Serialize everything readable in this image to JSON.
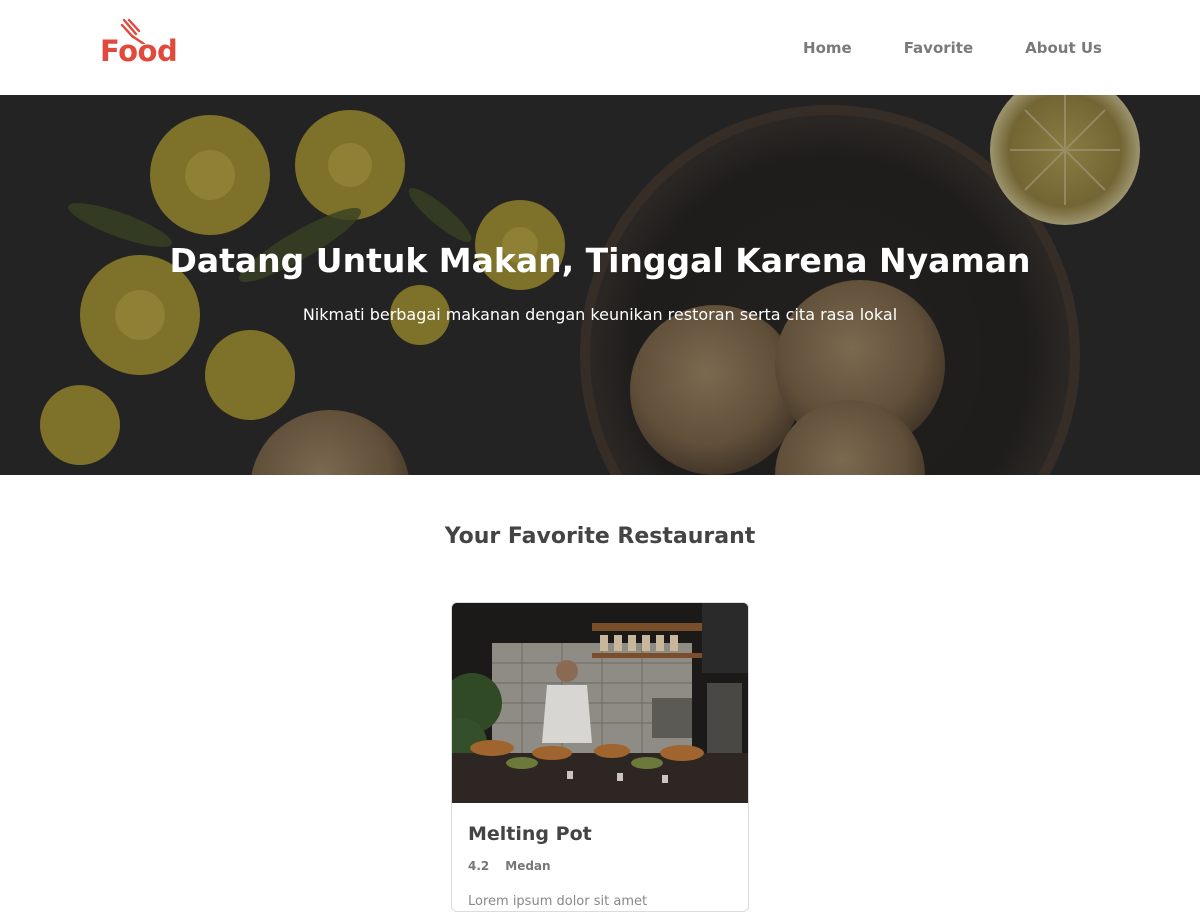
{
  "brand": {
    "logo_text": "Food",
    "accent_color": "#e0493b",
    "icon": "fork-icon"
  },
  "nav": {
    "items": [
      {
        "label": "Home"
      },
      {
        "label": "Favorite"
      },
      {
        "label": "About Us"
      }
    ]
  },
  "hero": {
    "title": "Datang Untuk Makan, Tinggal Karena Nyaman",
    "subtitle": "Nikmati berbagai makanan dengan keunikan restoran serta cita rasa lokal"
  },
  "favorites": {
    "heading": "Your Favorite Restaurant",
    "restaurants": [
      {
        "name": "Melting Pot",
        "rating": "4.2",
        "city": "Medan",
        "description": "Lorem ipsum dolor sit amet"
      }
    ]
  }
}
